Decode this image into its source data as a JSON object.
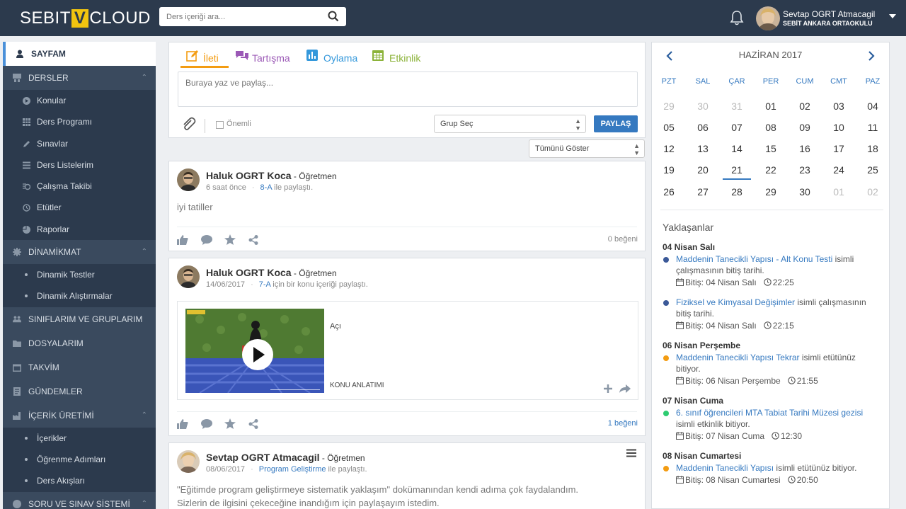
{
  "header": {
    "logo_left": "SEBIT",
    "logo_v": "V",
    "logo_right": "CLOUD",
    "search_placeholder": "Ders içeriği ara...",
    "user_name": "Sevtap OGRT Atmacagil",
    "user_school": "SEBİT ANKARA ORTAOKULU"
  },
  "sidebar": {
    "active": "SAYFAM",
    "dersler": "DERSLER",
    "dersler_items": [
      "Konular",
      "Ders Programı",
      "Sınavlar",
      "Ders Listelerim",
      "Çalışma Takibi",
      "Etütler",
      "Raporlar"
    ],
    "dinamikmat": "DİNAMİKMAT",
    "dinamikmat_items": [
      "Dinamik Testler",
      "Dinamik Alıştırmalar"
    ],
    "siniflar": "SINIFLARIM VE GRUPLARIM",
    "dosyalar": "DOSYALARIM",
    "takvim": "TAKVİM",
    "gundemler": "GÜNDEMLER",
    "icerik": "İÇERİK ÜRETİMİ",
    "icerik_items": [
      "İçerikler",
      "Öğrenme Adımları",
      "Ders Akışları"
    ],
    "soru": "SORU VE SINAV SİSTEMİ"
  },
  "composer": {
    "tabs": [
      "İleti",
      "Tartışma",
      "Oylama",
      "Etkinlik"
    ],
    "placeholder": "Buraya yaz ve paylaş...",
    "important_label": "Önemli",
    "group_select": "Grup Seç",
    "share_button": "PAYLAŞ"
  },
  "filter": {
    "value": "Tümünü Göster"
  },
  "posts": [
    {
      "author": "Haluk OGRT Koca",
      "role": " - Öğretmen",
      "time": "6 saat önce",
      "target": "8-A",
      "action": " ile paylaştı.",
      "body": "iyi tatiller",
      "likes": "0 beğeni"
    },
    {
      "author": "Haluk OGRT Koca",
      "role": " - Öğretmen",
      "time": "14/06/2017",
      "target": "7-A",
      "action": " için bir konu içeriği paylaştı.",
      "content_title": "Açı",
      "content_subtitle": "KONU ANLATIMI",
      "likes": "1 beğeni"
    },
    {
      "author": "Sevtap OGRT Atmacagil",
      "role": " - Öğretmen",
      "time": "08/06/2017",
      "target": "Program Geliştirme",
      "action": " ile paylaştı.",
      "body1": "\"Eğitimde program geliştirmeye sistematik yaklaşım\" dokümanından kendi adıma çok faydalandım.",
      "body2": "Sizlerin de ilgisini çekeceğine inandığım için paylaşayım istedim."
    }
  ],
  "calendar": {
    "month": "HAZİRAN 2017",
    "weekdays": [
      "PZT",
      "SAL",
      "ÇAR",
      "PER",
      "CUM",
      "CMT",
      "PAZ"
    ],
    "weeks": [
      [
        "29",
        "30",
        "31",
        "01",
        "02",
        "03",
        "04"
      ],
      [
        "05",
        "06",
        "07",
        "08",
        "09",
        "10",
        "11"
      ],
      [
        "12",
        "13",
        "14",
        "15",
        "16",
        "17",
        "18"
      ],
      [
        "19",
        "20",
        "21",
        "22",
        "23",
        "24",
        "25"
      ],
      [
        "26",
        "27",
        "28",
        "29",
        "30",
        "01",
        "02"
      ]
    ],
    "today": "21"
  },
  "upcoming": {
    "title": "Yaklaşanlar",
    "groups": [
      {
        "date": "04 Nisan Salı",
        "items": [
          {
            "color": "#3b5998",
            "link": "Maddenin Tanecikli Yapısı - Alt Konu Testi",
            "text": " isimli çalışmasının bitiş tarihi.",
            "due": "Bitiş: 04 Nisan Salı",
            "time": "22:25"
          },
          {
            "color": "#3b5998",
            "link": "Fiziksel ve Kimyasal Değişimler",
            "text": " isimli çalışmasının bitiş tarihi.",
            "due": "Bitiş: 04 Nisan Salı",
            "time": "22:15"
          }
        ]
      },
      {
        "date": "06 Nisan Perşembe",
        "items": [
          {
            "color": "#f39c12",
            "link": "Maddenin Tanecikli Yapısı Tekrar",
            "text": " isimli etütünüz bitiyor.",
            "due": "Bitiş: 06 Nisan Perşembe",
            "time": "21:55"
          }
        ]
      },
      {
        "date": "07 Nisan Cuma",
        "items": [
          {
            "color": "#2ecc71",
            "link": "6. sınıf öğrencileri MTA Tabiat Tarihi Müzesi gezisi",
            "text": " isimli etkinlik bitiyor.",
            "due": "Bitiş: 07 Nisan Cuma",
            "time": "12:30"
          }
        ]
      },
      {
        "date": "08 Nisan Cumartesi",
        "items": [
          {
            "color": "#f39c12",
            "link": "Maddenin Tanecikli Yapısı",
            "text": " isimli etütünüz bitiyor.",
            "due": "Bitiş: 08 Nisan Cumartesi",
            "time": "20:50"
          }
        ]
      }
    ]
  }
}
